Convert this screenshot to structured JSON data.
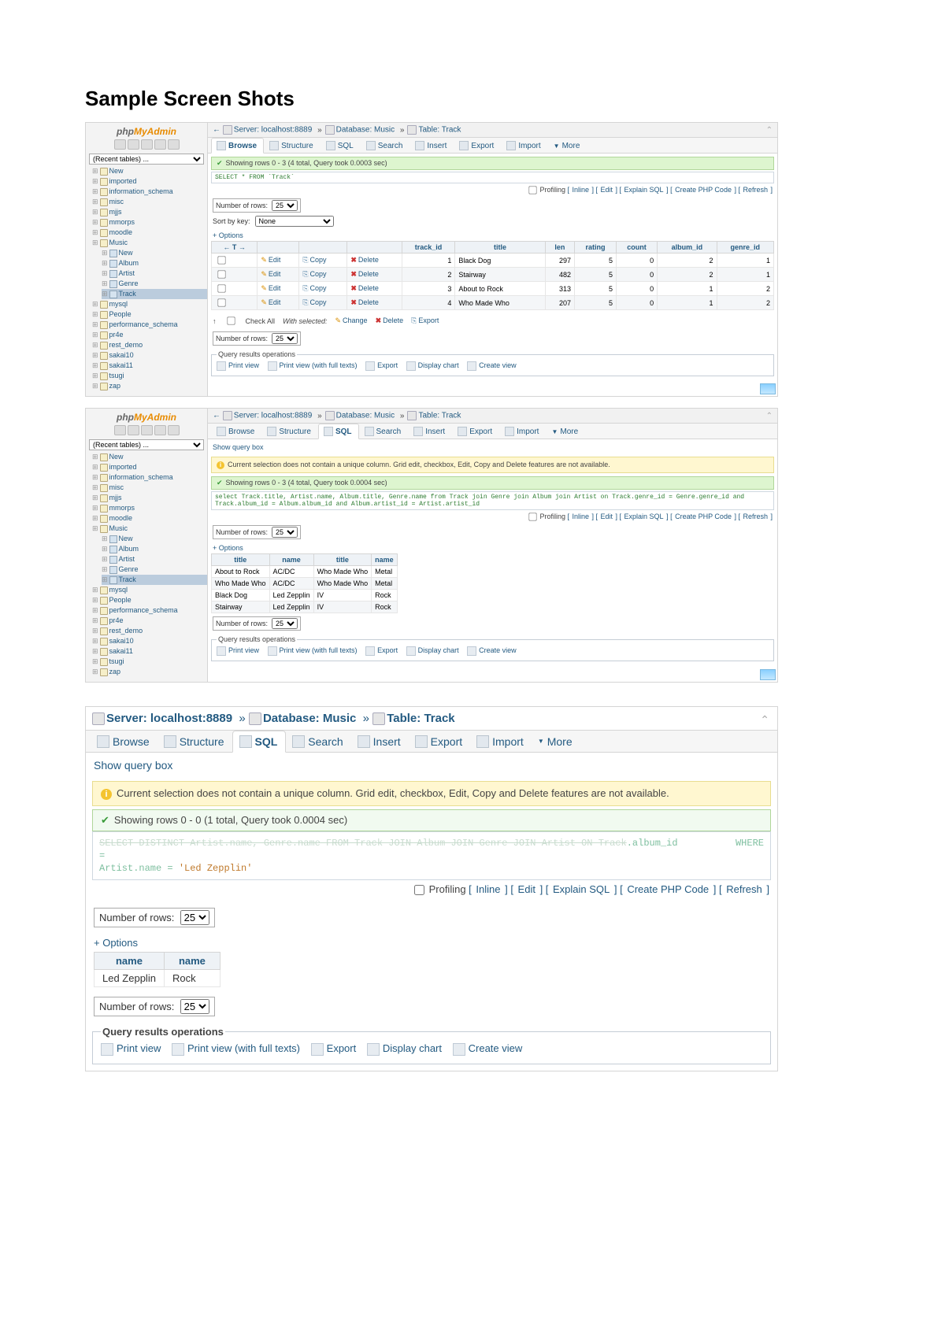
{
  "page_title": "Sample Screen Shots",
  "pma_logo": {
    "p1": "php",
    "p2": "MyAdmin"
  },
  "recent_tables": "(Recent tables) ...",
  "tree_dbs": [
    "New",
    "imported",
    "information_schema",
    "misc",
    "mjjs",
    "mmorps",
    "moodle",
    "Music",
    "mysql",
    "People",
    "performance_schema",
    "pr4e",
    "rest_demo",
    "sakai10",
    "sakai11",
    "tsugi",
    "zap"
  ],
  "music_tables": [
    "New",
    "Album",
    "Artist",
    "Genre",
    "Track"
  ],
  "tabs": [
    "Browse",
    "Structure",
    "SQL",
    "Search",
    "Insert",
    "Export",
    "Import",
    "More"
  ],
  "breadcrumb": {
    "server_lbl": "Server:",
    "server": "localhost:8889",
    "db_lbl": "Database:",
    "db": "Music",
    "tbl_lbl": "Table:",
    "tbl": "Track"
  },
  "linkbar": {
    "profiling": "Profiling",
    "inline": "Inline",
    "edit": "Edit",
    "explain": "Explain SQL",
    "php": "Create PHP Code",
    "refresh": "Refresh"
  },
  "num_rows_lbl": "Number of rows:",
  "num_rows_val": "25",
  "sort_lbl": "Sort by key:",
  "sort_val": "None",
  "options": "+ Options",
  "s1": {
    "showing": "Showing rows 0 - 3 (4 total, Query took 0.0003 sec)",
    "sql": "SELECT * FROM `Track`",
    "headers": [
      "",
      "",
      "",
      "",
      "track_id",
      "title",
      "len",
      "rating",
      "count",
      "album_id",
      "genre_id"
    ],
    "rows": [
      {
        "track_id": 1,
        "title": "Black Dog",
        "len": 297,
        "rating": 5,
        "count": 0,
        "album_id": 2,
        "genre_id": 1
      },
      {
        "track_id": 2,
        "title": "Stairway",
        "len": 482,
        "rating": 5,
        "count": 0,
        "album_id": 2,
        "genre_id": 1
      },
      {
        "track_id": 3,
        "title": "About to Rock",
        "len": 313,
        "rating": 5,
        "count": 0,
        "album_id": 1,
        "genre_id": 2
      },
      {
        "track_id": 4,
        "title": "Who Made Who",
        "len": 207,
        "rating": 5,
        "count": 0,
        "album_id": 1,
        "genre_id": 2
      }
    ],
    "act": {
      "edit": "Edit",
      "copy": "Copy",
      "delete": "Delete"
    },
    "check_all": "Check All",
    "with_sel": "With selected:",
    "change": "Change",
    "delete": "Delete",
    "export": "Export"
  },
  "qops": {
    "legend": "Query results operations",
    "print": "Print view",
    "printfull": "Print view (with full texts)",
    "export": "Export",
    "chart": "Display chart",
    "view": "Create view"
  },
  "s2": {
    "show_query": "Show query box",
    "warn": "Current selection does not contain a unique column. Grid edit, checkbox, Edit, Copy and Delete features are not available.",
    "showing": "Showing rows 0 - 3 (4 total, Query took 0.0004 sec)",
    "sql": "select Track.title, Artist.name, Album.title, Genre.name from Track join Genre join Album join Artist on Track.genre_id = Genre.genre_id and Track.album_id = Album.album_id and Album.artist_id = Artist.artist_id",
    "headers": [
      "title",
      "name",
      "title",
      "name"
    ],
    "rows": [
      [
        "About to Rock",
        "AC/DC",
        "Who Made Who",
        "Metal"
      ],
      [
        "Who Made Who",
        "AC/DC",
        "Who Made Who",
        "Metal"
      ],
      [
        "Black Dog",
        "Led Zepplin",
        "IV",
        "Rock"
      ],
      [
        "Stairway",
        "Led Zepplin",
        "IV",
        "Rock"
      ]
    ]
  },
  "s3": {
    "show_query": "Show query box",
    "warn": "Current selection does not contain a unique column. Grid edit, checkbox, Edit, Copy and Delete features are not available.",
    "showing": "Showing rows 0 - 0 (1 total, Query took 0.0004 sec)",
    "sql_faint": "SELECT DISTINCT Artist.name, Genre.name FROM Track JOIN Album JOIN Genre JOIN Artist ON Track",
    "sql_tail": ".album_id",
    "sql_eq": "=",
    "sql_where": "WHERE",
    "sql_line2": "Artist.name = 'Led Zepplin'",
    "headers": [
      "name",
      "name"
    ],
    "rows": [
      [
        "Led Zepplin",
        "Rock"
      ]
    ]
  }
}
